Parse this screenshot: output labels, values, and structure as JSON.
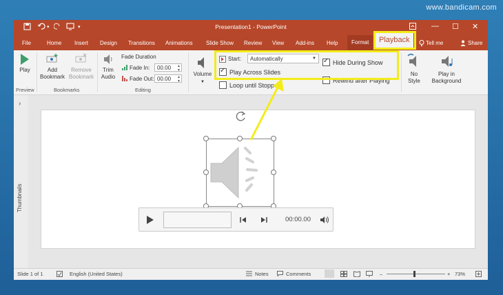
{
  "watermark": "www.bandicam.com",
  "titlebar": {
    "title": "Presentation1 - PowerPoint",
    "qa_save_icon": "save-icon",
    "qa_undo_icon": "undo-icon",
    "qa_redo_icon": "redo-icon",
    "minimize": "—",
    "restore": "☐",
    "close": "✕"
  },
  "tabs": {
    "file": "File",
    "home": "Home",
    "insert": "Insert",
    "design": "Design",
    "transitions": "Transitions",
    "animations": "Animations",
    "slideshow": "Slide Show",
    "review": "Review",
    "view": "View",
    "addins": "Add-ins",
    "help": "Help",
    "format": "Format",
    "playback": "Playback",
    "tellme": "Tell me",
    "share": "Share"
  },
  "ribbon": {
    "preview": {
      "play": "Play",
      "label": "Preview"
    },
    "bookmarks": {
      "add_1": "Add",
      "add_2": "Bookmark",
      "remove_1": "Remove",
      "remove_2": "Bookmark",
      "label": "Bookmarks"
    },
    "editing": {
      "trim_1": "Trim",
      "trim_2": "Audio",
      "fade_duration": "Fade Duration",
      "fade_in_label": "Fade In:",
      "fade_in_value": "00.00",
      "fade_out_label": "Fade Out:",
      "fade_out_value": "00.00",
      "label": "Editing"
    },
    "audio_options": {
      "volume": "Volume",
      "start_label": "Start:",
      "start_value": "Automatically",
      "play_across_slides": "Play Across Slides",
      "play_across_slides_checked": true,
      "loop_until_stopped": "Loop until Stopped",
      "loop_checked": false,
      "hide_during_show": "Hide During Show",
      "hide_checked": true,
      "rewind_after_playing": "Rewind after Playing",
      "rewind_checked": false
    },
    "audio_styles": {
      "no_style_1": "No",
      "no_style_2": "Style",
      "play_bg_1": "Play in",
      "play_bg_2": "Background"
    }
  },
  "left_pane": {
    "thumbnails": "Thumbnails",
    "expand": "›"
  },
  "player": {
    "time": "00:00.00"
  },
  "statusbar": {
    "slide": "Slide 1 of 1",
    "language": "English (United States)",
    "notes": "Notes",
    "comments": "Comments",
    "zoom": "73%"
  },
  "colors": {
    "accent": "#b7472a",
    "highlight": "#f3ec19"
  }
}
